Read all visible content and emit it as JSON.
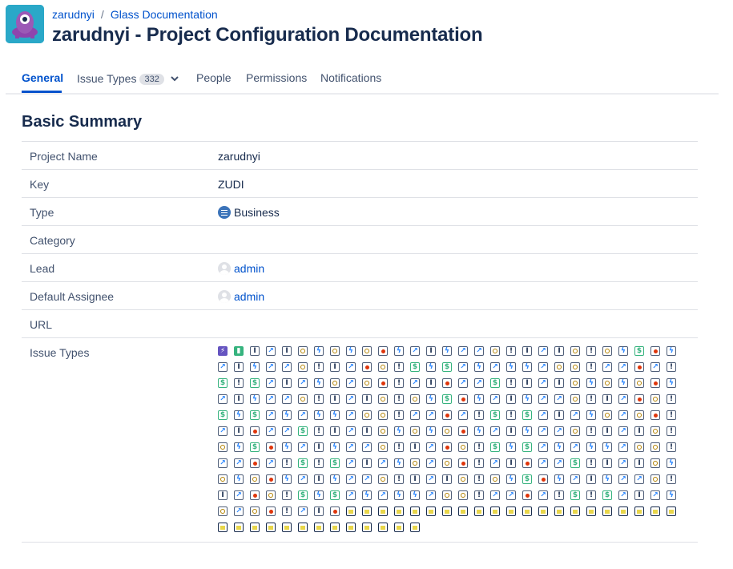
{
  "header": {
    "breadcrumb": [
      "zarudnyi",
      "/",
      "Glass Documentation"
    ],
    "title": "zarudnyi - Project Configuration Documentation"
  },
  "tabs": [
    {
      "label": "General",
      "active": true
    },
    {
      "label": "Issue Types",
      "count": "332"
    },
    {
      "label": "People"
    },
    {
      "label": "Permissions"
    },
    {
      "label": "Notifications"
    }
  ],
  "section": {
    "title": "Basic Summary"
  },
  "summary": {
    "project_name": {
      "label": "Project Name",
      "value": "zarudnyi"
    },
    "key": {
      "label": "Key",
      "value": "ZUDI"
    },
    "type": {
      "label": "Type",
      "value": "Business"
    },
    "category": {
      "label": "Category",
      "value": ""
    },
    "lead": {
      "label": "Lead",
      "value": "admin"
    },
    "default_assignee": {
      "label": "Default Assignee",
      "value": "admin"
    },
    "url": {
      "label": "URL",
      "value": ""
    },
    "issue_types": {
      "label": "Issue Types"
    }
  },
  "colors": {
    "link": "#0052cc",
    "text": "#172b4d",
    "accent": "#0052cc"
  }
}
